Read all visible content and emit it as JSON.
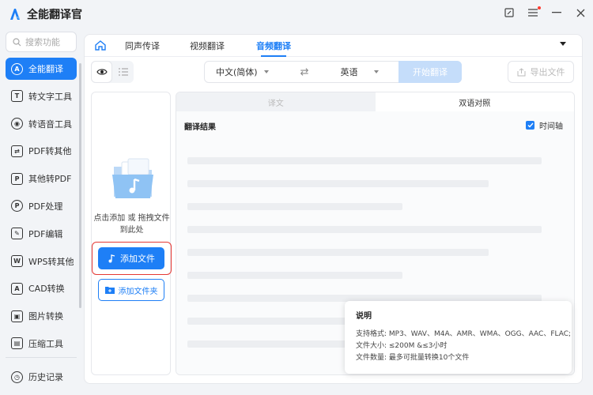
{
  "app": {
    "title": "全能翻译官"
  },
  "sidebar": {
    "search_placeholder": "搜索功能",
    "items": [
      {
        "label": "全能翻译",
        "icon": "A"
      },
      {
        "label": "转文字工具",
        "icon": "T"
      },
      {
        "label": "转语音工具",
        "icon": "◉"
      },
      {
        "label": "PDF转其他",
        "icon": "⇄"
      },
      {
        "label": "其他转PDF",
        "icon": "P"
      },
      {
        "label": "PDF处理",
        "icon": "P"
      },
      {
        "label": "PDF编辑",
        "icon": "✎"
      },
      {
        "label": "WPS转其他",
        "icon": "W"
      },
      {
        "label": "CAD转换",
        "icon": "A"
      },
      {
        "label": "图片转换",
        "icon": "▣"
      },
      {
        "label": "压缩工具",
        "icon": "▤"
      }
    ],
    "history": "历史记录"
  },
  "tabs": [
    "同声传译",
    "视频翻译",
    "音频翻译"
  ],
  "toolbar": {
    "source_lang": "中文(简体)",
    "target_lang": "英语",
    "start_label": "开始翻译",
    "export_label": "导出文件"
  },
  "upload": {
    "drop_line1": "点击添加 或 拖拽文件",
    "drop_line2": "到此处",
    "add_file": "添加文件",
    "add_folder": "添加文件夹"
  },
  "result": {
    "tab_translation": "译文",
    "tab_bilingual": "双语对照",
    "title": "翻译结果",
    "timeline_label": "时间轴",
    "timeline_checked": true
  },
  "info": {
    "title": "说明",
    "formats": "支持格式:   MP3、WAV、M4A、AMR、WMA、OGG、AAC、FLAC;",
    "size": "文件大小:   ≤200M &≤3小时",
    "count": "文件数量:   最多可批量转换10个文件"
  },
  "colors": {
    "accent": "#1e7ff6",
    "highlight_border": "#e53935"
  }
}
